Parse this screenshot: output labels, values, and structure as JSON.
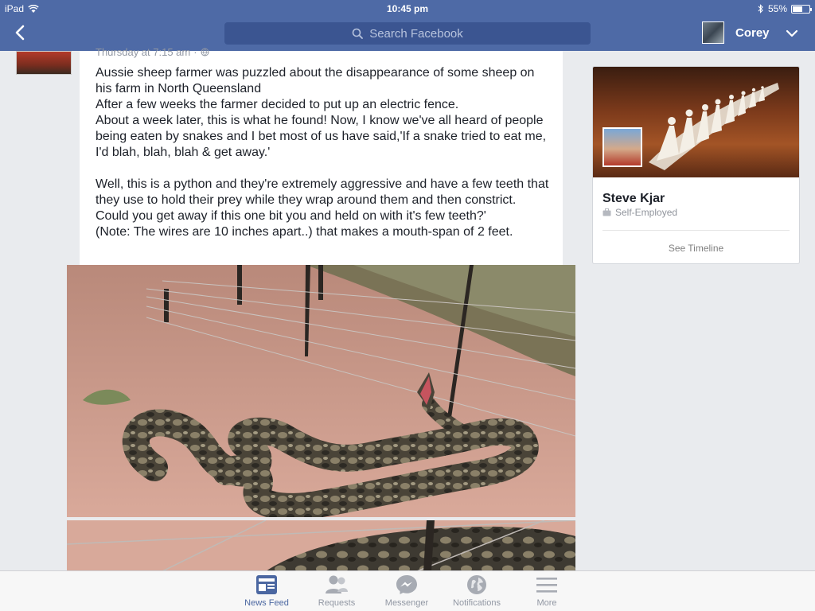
{
  "status_bar": {
    "carrier": "iPad",
    "time": "10:45 pm",
    "battery": "55%",
    "battery_level": 0.55
  },
  "nav": {
    "search_placeholder": "Search Facebook",
    "user_name": "Corey"
  },
  "post": {
    "timestamp": "Thursday at 7:15 am",
    "lines": [
      "Aussie sheep farmer was puzzled  about the disappearance of some sheep on his farm in North Queensland",
      "After a few weeks the farmer decided to put up an electric fence.",
      "About a week later, this is what he found! Now, I know we've all heard of people being eaten by snakes and I bet most of us have said,'If a snake tried to eat me, I'd  blah, blah, blah & get away.'",
      "Well, this is a python and they're extremely aggressive and have a few teeth that they use to hold their prey while they wrap around them and then constrict.",
      "Could you get away if this one bit you and held on with it's few teeth?'",
      "(Note: The wires are 10 inches apart..) that makes a mouth-span of 2 feet."
    ]
  },
  "profile_card": {
    "name": "Steve Kjar",
    "work": "Self-Employed",
    "link": "See Timeline"
  },
  "tabs": [
    {
      "label": "News Feed",
      "icon": "news-feed-icon",
      "active": true
    },
    {
      "label": "Requests",
      "icon": "requests-icon",
      "active": false
    },
    {
      "label": "Messenger",
      "icon": "messenger-icon",
      "active": false
    },
    {
      "label": "Notifications",
      "icon": "notifications-icon",
      "active": false
    },
    {
      "label": "More",
      "icon": "more-icon",
      "active": false
    }
  ],
  "colors": {
    "brand": "#4e6aa6",
    "active_tab": "#4b67a1"
  }
}
